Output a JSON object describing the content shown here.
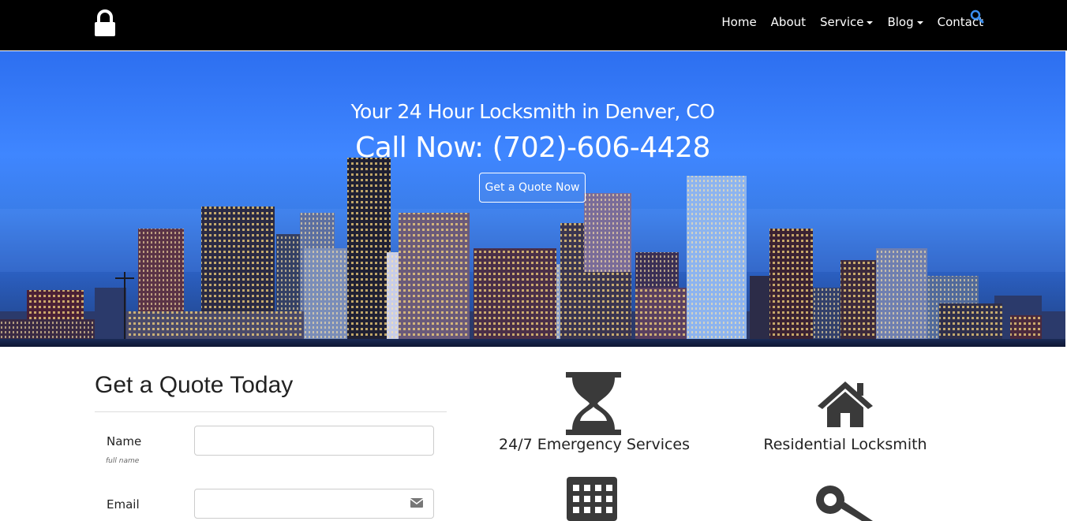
{
  "nav": {
    "logo_icon": "lock-icon",
    "items": [
      {
        "label": "Home",
        "dropdown": false
      },
      {
        "label": "About",
        "dropdown": false
      },
      {
        "label": "Service",
        "dropdown": true
      },
      {
        "label": "Blog",
        "dropdown": true
      },
      {
        "label": "Contact",
        "dropdown": false
      }
    ],
    "search_icon": "search-icon",
    "search_color": "#3a8ff0"
  },
  "hero": {
    "subtitle": "Your 24 Hour Locksmith in Denver, CO",
    "phone": "Call Now: (702)-606-4428",
    "cta_label": "Get a Quote Now"
  },
  "quote": {
    "title": "Get a Quote Today",
    "fields": [
      {
        "label": "Name",
        "hint": "full name",
        "value": "",
        "placeholder": ""
      },
      {
        "label": "Email",
        "hint": "",
        "value": "",
        "placeholder": "",
        "icon": "envelope-icon"
      }
    ]
  },
  "services": [
    {
      "label": "24/7 Emergency Services",
      "icon": "hourglass-icon"
    },
    {
      "label": "Residential Locksmith",
      "icon": "home-icon"
    },
    {
      "label": "",
      "icon": "building-icon"
    },
    {
      "label": "",
      "icon": "key-icon"
    }
  ],
  "colors": {
    "navbar_bg": "#000000",
    "hero_sky": "#3f86ff",
    "icon_gray": "#3a3a3a"
  }
}
